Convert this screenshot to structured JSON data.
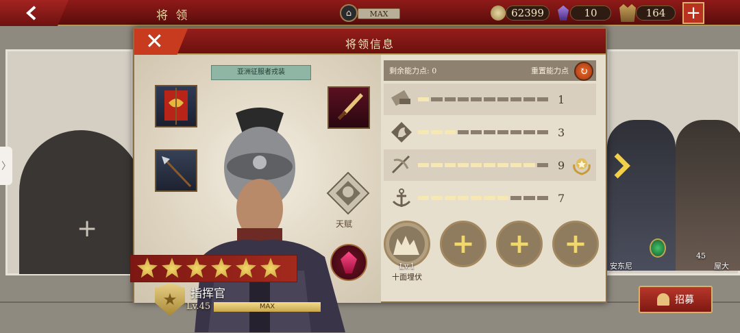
{
  "header": {
    "title": "将 领",
    "max_label": "MAX",
    "coins": "62399",
    "gems": "10",
    "troops": "164",
    "plus": "+"
  },
  "dialog": {
    "title": "将领信息",
    "close": "✕",
    "outfit_label": "亚洲征服者戎装",
    "talent_label": "天赋",
    "rank_name": "指挥官",
    "level": "Lv.45",
    "level_bar": "MAX",
    "star_count": 6,
    "points": {
      "label": "剩余能力点: 0",
      "reset_label": "重置能力点"
    },
    "stats": [
      {
        "name": "infantry-stat",
        "value": "1",
        "filled": 1,
        "total": 10
      },
      {
        "name": "cavalry-stat",
        "value": "3",
        "filled": 3,
        "total": 10
      },
      {
        "name": "archery-stat",
        "value": "9",
        "filled": 9,
        "total": 10
      },
      {
        "name": "navy-stat",
        "value": "7",
        "filled": 7,
        "total": 10
      }
    ],
    "skill": {
      "level": "Lv.1",
      "name": "十面埋伏"
    },
    "add_slot": "+"
  },
  "background": {
    "left_plus": "+",
    "hero1_name": "安东尼",
    "hero1_level": "45",
    "hero2_name": "屋大",
    "recruit_label": "招募",
    "side_tab": "〉"
  },
  "colors": {
    "header_red": "#8e1a18",
    "gold": "#e3c46c",
    "panel": "#e7dfce"
  }
}
